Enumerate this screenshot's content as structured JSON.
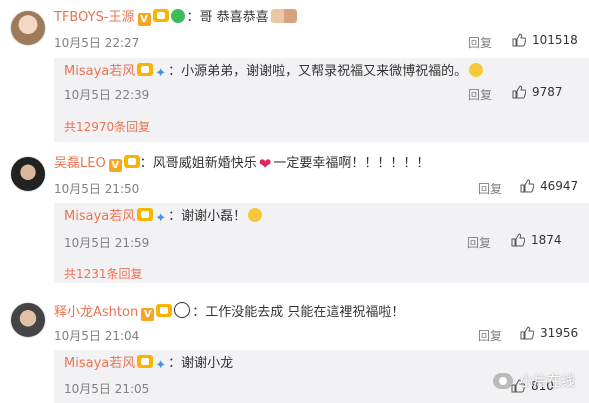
{
  "comments": [
    {
      "username": "TFBOYS-王源",
      "text": "哥 恭喜恭喜",
      "time": "10月5日 22:27",
      "reply_label": "回复",
      "likes": "101518",
      "reply": {
        "username": "Misaya若风",
        "text": "小源弟弟，谢谢啦，又帮录祝福又来微博祝福的。",
        "time": "10月5日 22:39",
        "reply_label": "回复",
        "likes": "9787"
      },
      "more": "共12970条回复"
    },
    {
      "username": "吴磊LEO",
      "text": "风哥威姐新婚快乐",
      "text_after": "一定要幸福啊！！！！！！",
      "time": "10月5日 21:50",
      "reply_label": "回复",
      "likes": "46947",
      "reply": {
        "username": "Misaya若风",
        "text": "谢谢小磊！",
        "time": "10月5日 21:59",
        "reply_label": "回复",
        "likes": "1874"
      },
      "more": "共1231条回复"
    },
    {
      "username": "释小龙Ashton",
      "text": "工作没能去成 只能在這裡祝福啦！",
      "time": "10月5日 21:04",
      "reply_label": "回复",
      "likes": "31956",
      "reply": {
        "username": "Misaya若风",
        "text": "谢谢小龙",
        "time": "10月5日 21:05",
        "reply_label": "回复",
        "likes": "810"
      }
    }
  ],
  "verified_badge": "V",
  "watermark": "小片在线",
  "colors": {
    "username": "#eb7350",
    "subbox_bg": "#f2f2f5",
    "meta": "#808080"
  }
}
